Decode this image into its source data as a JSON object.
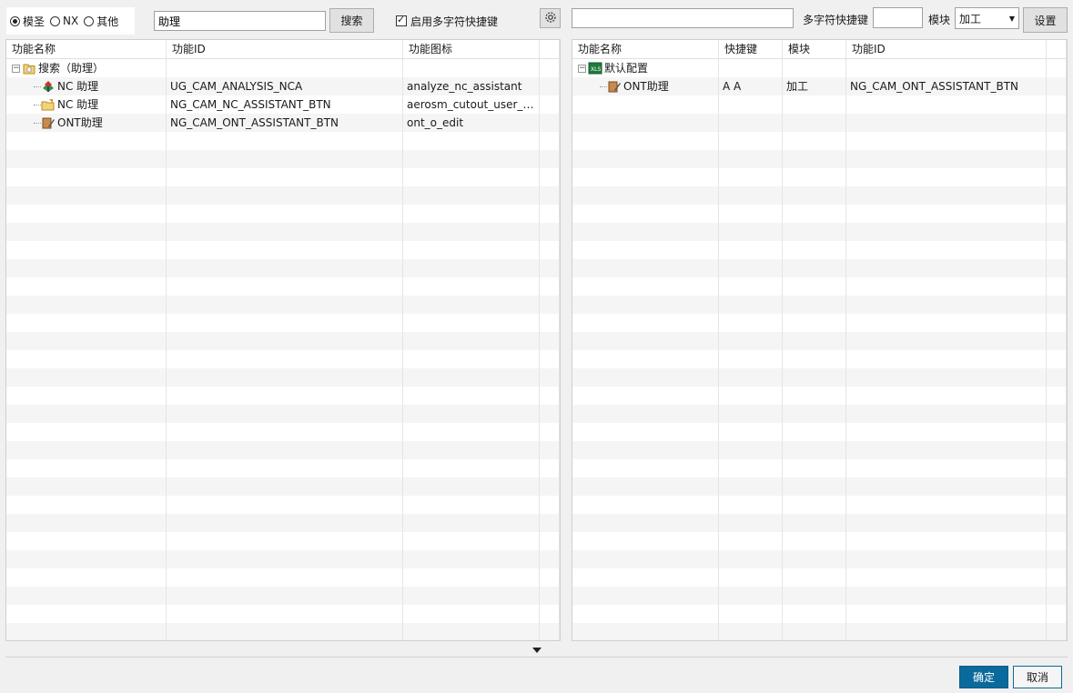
{
  "toolbar": {
    "radio_options": [
      {
        "label": "模圣",
        "checked": true
      },
      {
        "label": "NX",
        "checked": false
      },
      {
        "label": "其他",
        "checked": false
      }
    ],
    "search_value": "助理",
    "search_button": "搜索",
    "multi_char_checkbox": "启用多字符快捷键",
    "right_input_value": "",
    "multi_char_label": "多字符快捷键",
    "multi_char_value": "",
    "module_label": "模块",
    "module_selected": "加工",
    "settings_button": "设置"
  },
  "left_table": {
    "headers": [
      "功能名称",
      "功能ID",
      "功能图标"
    ],
    "root": {
      "label": "搜索（助理）"
    },
    "rows": [
      {
        "name": "NC 助理",
        "id": "UG_CAM_ANALYSIS_NCA",
        "icon": "analyze_nc_assistant",
        "icon_name": "nc-analysis-icon"
      },
      {
        "name": "NC 助理",
        "id": "NG_CAM_NC_ASSISTANT_BTN",
        "icon": "aerosm_cutout_user_d...",
        "icon_name": "folder-edit-icon"
      },
      {
        "name": "ONT助理",
        "id": "NG_CAM_ONT_ASSISTANT_BTN",
        "icon": "ont_o_edit",
        "icon_name": "ont-edit-icon"
      }
    ]
  },
  "right_table": {
    "headers": [
      "功能名称",
      "快捷键",
      "模块",
      "功能ID"
    ],
    "root": {
      "label": "默认配置"
    },
    "rows": [
      {
        "name": "ONT助理",
        "shortcut": "A A",
        "module": "加工",
        "id": "NG_CAM_ONT_ASSISTANT_BTN"
      }
    ]
  },
  "footer": {
    "ok_button": "确定",
    "cancel_button": "取消"
  },
  "colors": {
    "primary": "#0b6a9c",
    "background": "#f0f0f0"
  }
}
